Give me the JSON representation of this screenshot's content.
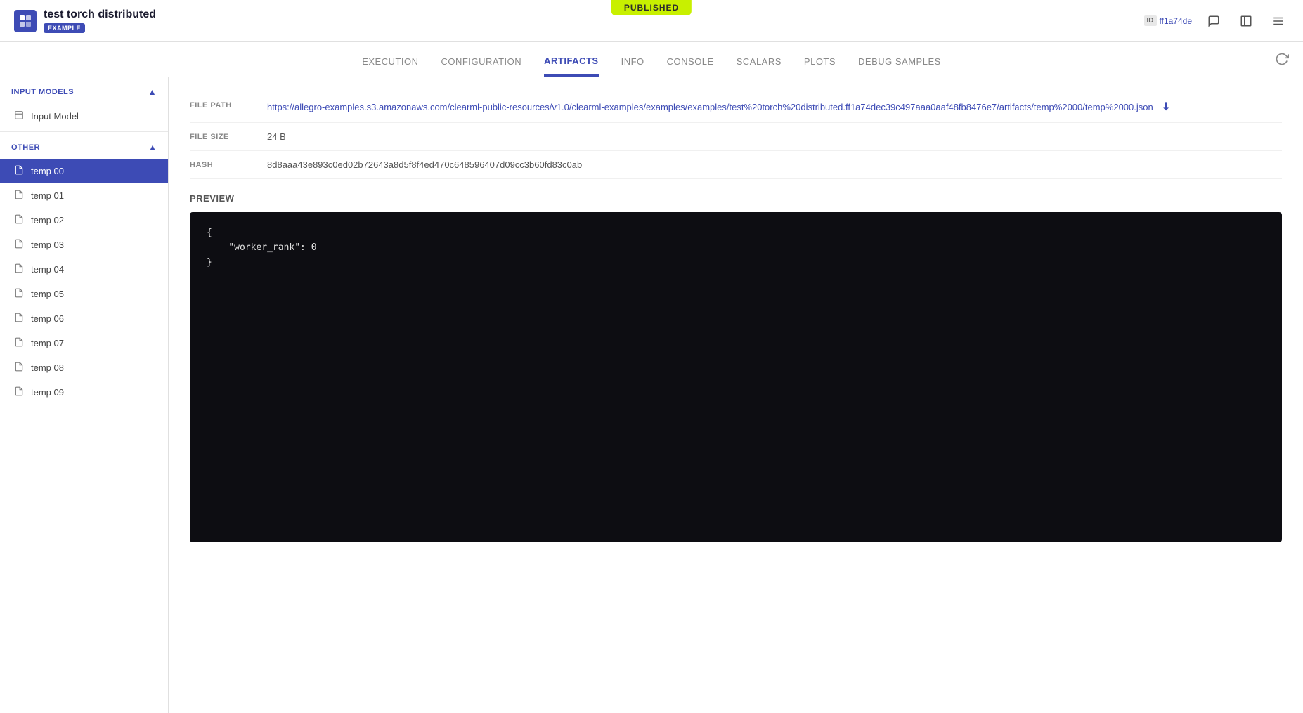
{
  "published_banner": "PUBLISHED",
  "header": {
    "title": "test torch distributed",
    "badge": "EXAMPLE",
    "id_label": "ID",
    "id_value": "ff1a74de"
  },
  "nav": {
    "tabs": [
      {
        "id": "execution",
        "label": "EXECUTION"
      },
      {
        "id": "configuration",
        "label": "CONFIGURATION"
      },
      {
        "id": "artifacts",
        "label": "ARTIFACTS"
      },
      {
        "id": "info",
        "label": "INFO"
      },
      {
        "id": "console",
        "label": "CONSOLE"
      },
      {
        "id": "scalars",
        "label": "SCALARS"
      },
      {
        "id": "plots",
        "label": "PLOTS"
      },
      {
        "id": "debug_samples",
        "label": "DEBUG SAMPLES"
      }
    ],
    "active_tab": "artifacts"
  },
  "sidebar": {
    "input_models_header": "INPUT MODELS",
    "input_model_label": "Input Model",
    "other_header": "OTHER",
    "items": [
      {
        "id": "temp00",
        "label": "temp 00",
        "active": true
      },
      {
        "id": "temp01",
        "label": "temp 01",
        "active": false
      },
      {
        "id": "temp02",
        "label": "temp 02",
        "active": false
      },
      {
        "id": "temp03",
        "label": "temp 03",
        "active": false
      },
      {
        "id": "temp04",
        "label": "temp 04",
        "active": false
      },
      {
        "id": "temp05",
        "label": "temp 05",
        "active": false
      },
      {
        "id": "temp06",
        "label": "temp 06",
        "active": false
      },
      {
        "id": "temp07",
        "label": "temp 07",
        "active": false
      },
      {
        "id": "temp08",
        "label": "temp 08",
        "active": false
      },
      {
        "id": "temp09",
        "label": "temp 09",
        "active": false
      }
    ]
  },
  "artifact": {
    "file_path_label": "FILE PATH",
    "file_path_value": "https://allegro-examples.s3.amazonaws.com/clearml-public-resources/v1.0/clearml-examples/examples/examples/test%20torch%20distributed.ff1a74dec39c497aaa0aaf48fb8476e7/artifacts/temp%2000/temp%2000.json",
    "file_size_label": "FILE SIZE",
    "file_size_value": "24 B",
    "hash_label": "HASH",
    "hash_value": "8d8aaa43e893c0ed02b72643a8d5f8f4ed470c648596407d09cc3b60fd83c0ab",
    "preview_label": "PREVIEW",
    "preview_code": "{\n    \"worker_rank\": 0\n}"
  }
}
